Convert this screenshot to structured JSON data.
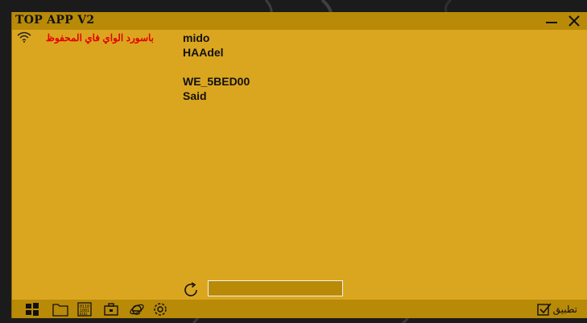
{
  "window": {
    "title": "TOP APP V2"
  },
  "wifi": {
    "label": "باسورد الواي فاي المحفوظ"
  },
  "networks": [
    "mido",
    "HAAdel",
    "",
    "WE_5BED00",
    "Said"
  ],
  "input": {
    "value": ""
  },
  "taskbar": {
    "apply_label": "تطبيق"
  },
  "colors": {
    "window_bg": "#dba61f",
    "titlebar_bg": "#b88a08",
    "wifi_label": "#e30000"
  }
}
